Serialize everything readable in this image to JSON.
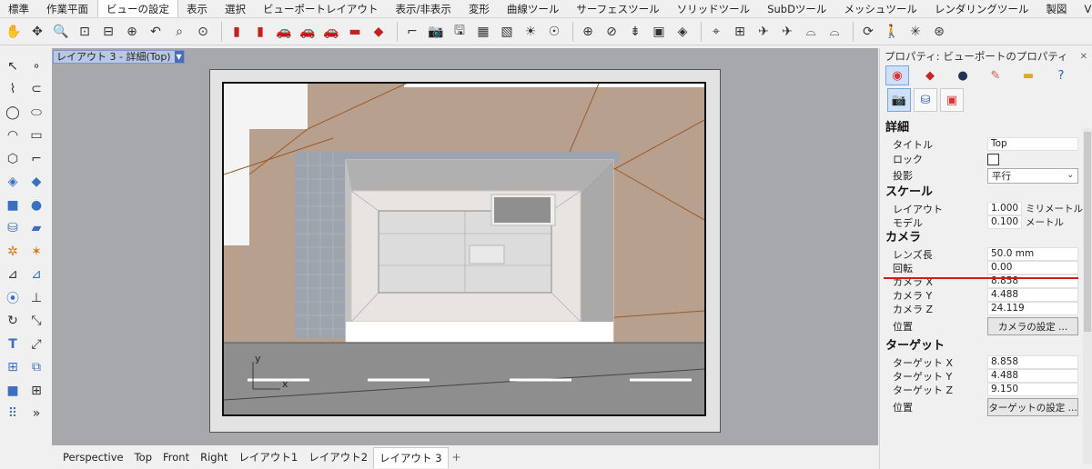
{
  "tabs": [
    "標準",
    "作業平面",
    "ビューの設定",
    "表示",
    "選択",
    "ビューポートレイアウト",
    "表示/非表示",
    "変形",
    "曲線ツール",
    "サーフェスツール",
    "ソリッドツール",
    "SubDツール",
    "メッシュツール",
    "レンダリングツール",
    "製図",
    "V>>"
  ],
  "active_tab": "ビューの設定",
  "viewport": {
    "title": "レイアウト 3 - 詳細(Top)",
    "axis_y": "y",
    "axis_x": "x"
  },
  "bottom_tabs": [
    "Perspective",
    "Top",
    "Front",
    "Right",
    "レイアウト1",
    "レイアウト2",
    "レイアウト 3"
  ],
  "bottom_add": "+",
  "panel": {
    "header": "プロパティ: ビューポートのプロパティ",
    "detail_section": "詳細",
    "title_label": "タイトル",
    "title_value": "Top",
    "lock_label": "ロック",
    "projection_label": "投影",
    "projection_value": "平行",
    "scale_section": "スケール",
    "layout_label": "レイアウト",
    "layout_value": "1.000",
    "layout_unit": "ミリメートル",
    "model_label": "モデル",
    "model_value": "0.100",
    "model_unit": "メートル",
    "camera_section": "カメラ",
    "lens_label": "レンズ長",
    "lens_value": "50.0 mm",
    "rotation_label": "回転",
    "rotation_value": "0.00",
    "camx_label": "カメラ X",
    "camx_value": "8.858",
    "camy_label": "カメラ Y",
    "camy_value": "4.488",
    "camz_label": "カメラ Z",
    "camz_value": "24.119",
    "position_label": "位置",
    "camera_button": "カメラの設定 ...",
    "target_section": "ターゲット",
    "tx_label": "ターゲット X",
    "tx_value": "8.858",
    "ty_label": "ターゲット Y",
    "ty_value": "4.488",
    "tz_label": "ターゲット Z",
    "tz_value": "9.150",
    "target_position_label": "位置",
    "target_button": "ターゲットの設定 ..."
  },
  "colors": {
    "highlight": "#d21c1c",
    "ground": "#b8a08f",
    "road": "#8e8e8e",
    "viewport_bg": "#a6a8ab"
  }
}
